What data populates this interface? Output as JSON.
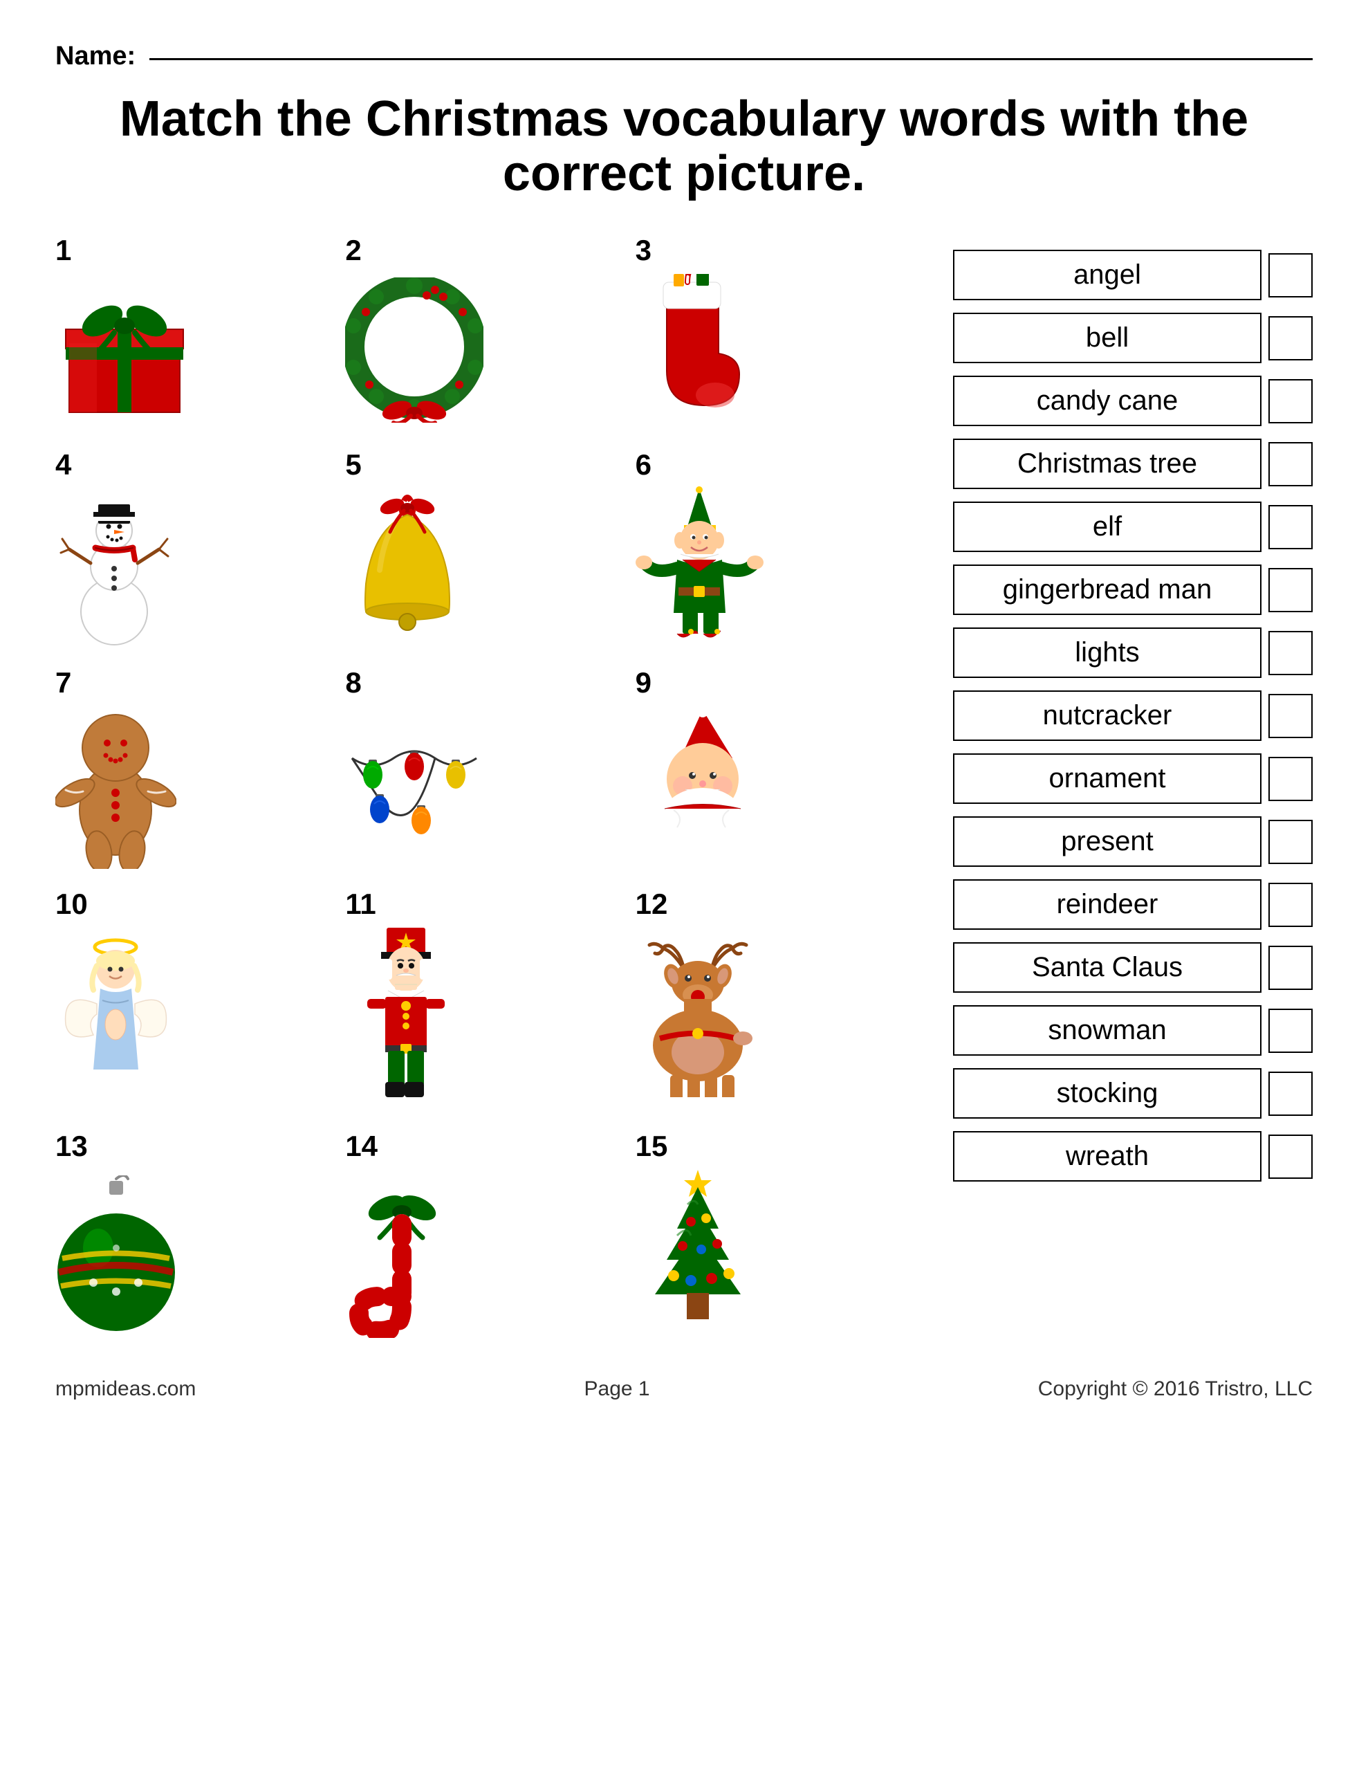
{
  "name_label": "Name:",
  "title": "Match the Christmas vocabulary words with the correct picture.",
  "items": [
    {
      "number": "1",
      "name": "present"
    },
    {
      "number": "2",
      "name": "wreath"
    },
    {
      "number": "3",
      "name": "stocking"
    },
    {
      "number": "4",
      "name": "snowman"
    },
    {
      "number": "5",
      "name": "bell"
    },
    {
      "number": "6",
      "name": "elf"
    },
    {
      "number": "7",
      "name": "gingerbread-man"
    },
    {
      "number": "8",
      "name": "lights"
    },
    {
      "number": "9",
      "name": "santa"
    },
    {
      "number": "10",
      "name": "angel"
    },
    {
      "number": "11",
      "name": "nutcracker"
    },
    {
      "number": "12",
      "name": "reindeer"
    },
    {
      "number": "13",
      "name": "ornament"
    },
    {
      "number": "14",
      "name": "candy-cane"
    },
    {
      "number": "15",
      "name": "christmas-tree"
    }
  ],
  "words": [
    "angel",
    "bell",
    "candy cane",
    "Christmas tree",
    "elf",
    "gingerbread man",
    "lights",
    "nutcracker",
    "ornament",
    "present",
    "reindeer",
    "Santa Claus",
    "snowman",
    "stocking",
    "wreath"
  ],
  "footer": {
    "website": "mpmideas.com",
    "page": "Page 1",
    "copyright": "Copyright © 2016 Tristro, LLC"
  }
}
